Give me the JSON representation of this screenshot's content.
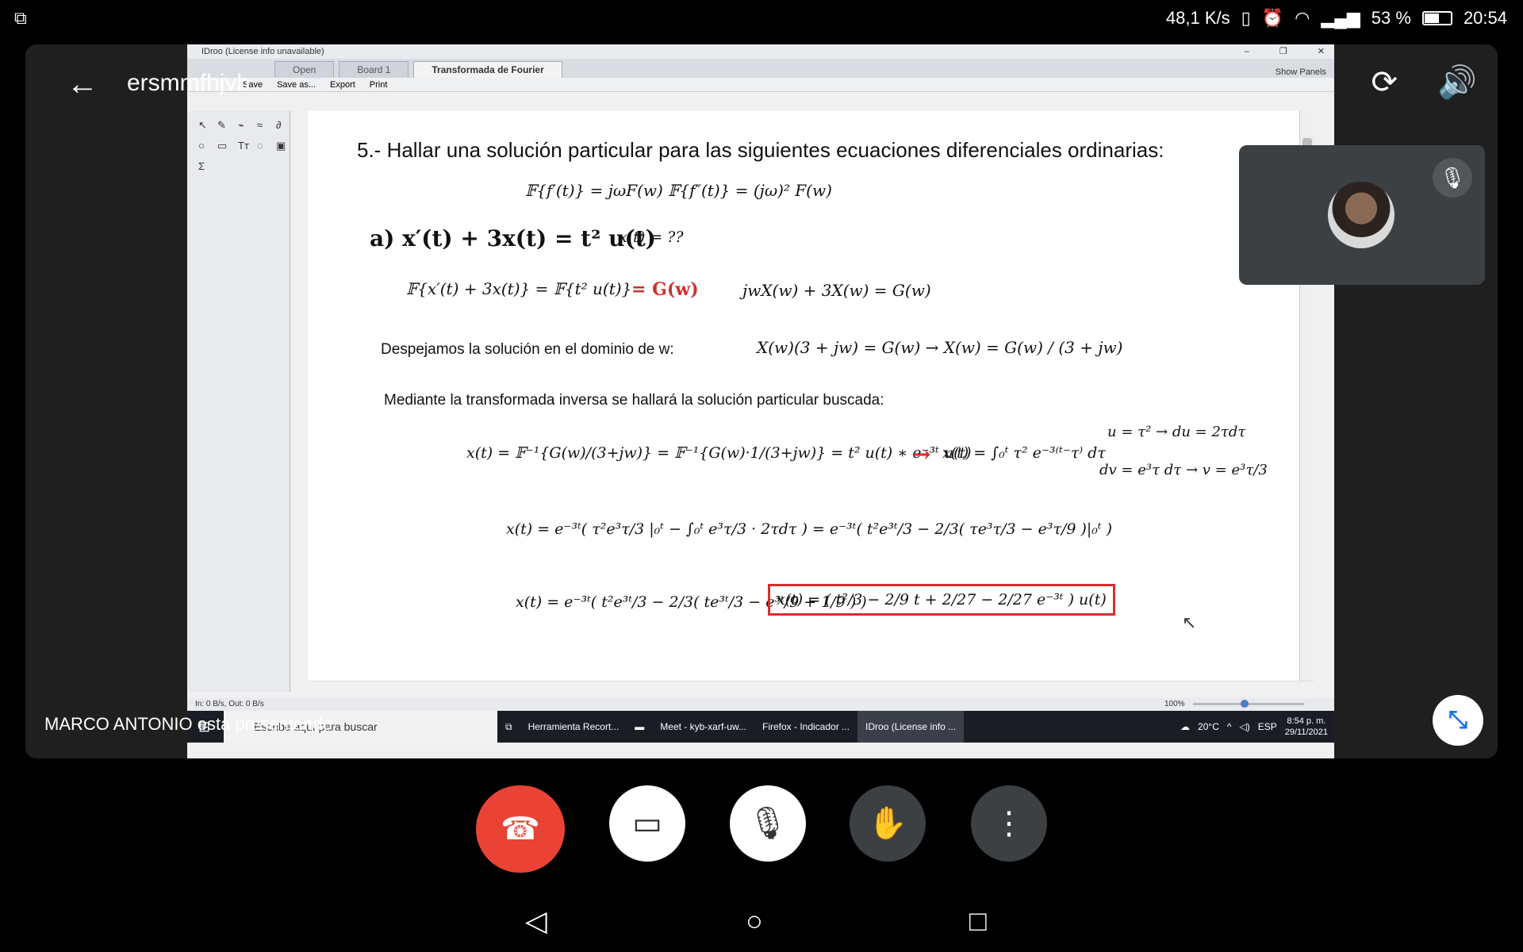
{
  "status": {
    "left_icon": "cast-icon",
    "speed": "48,1 K/s",
    "battery": "53 %",
    "time": "20:54"
  },
  "meeting": {
    "name": "ersmmfhjvb",
    "presenter_text": "MARCO ANTONIO está presentando"
  },
  "app": {
    "title": "IDroo (License info unavailable)",
    "tab1": "Open",
    "tab2": "Board 1",
    "tab3": "Transformada de Fourier",
    "show_panels": "Show Panels",
    "toolbar": {
      "save": "Save",
      "save_as": "Save as...",
      "export": "Export",
      "print": "Print"
    },
    "status_left": "In: 0 B/s, Out: 0 B/s",
    "zoom": "100%"
  },
  "board": {
    "heading": "5.- Hallar una solución particular para las siguientes ecuaciones diferenciales ordinarias:",
    "f1": "𝔽{f′(t)} = jωF(w)     𝔽{f″(t)} = (jω)² F(w)",
    "eq_a": "a)  x′(t) + 3x(t) = t² u(t)",
    "unknown": "x(t) = ??",
    "transform": "𝔽{x′(t) + 3x(t)} = 𝔽{t² u(t)}",
    "g_annot": "= G(w)",
    "freq_eq": "jwX(w) + 3X(w) = G(w)",
    "despejamos": "Despejamos la solución en el dominio de w:",
    "solve": "X(w)(3 + jw) = G(w) →  X(w) = G(w) / (3 + jw)",
    "mediante": "Mediante la transformada inversa se hallará la solución particular buscada:",
    "inverse": "x(t) = 𝔽⁻¹{G(w)/(3+jw)} = 𝔽⁻¹{G(w)·1/(3+jw)} = t² u(t) ∗ e⁻³ᵗ u(t)",
    "arrow": "→",
    "conv": "x(t) = ∫₀ᵗ τ² e⁻³⁽ᵗ⁻τ⁾ dτ",
    "sub1": "u = τ² → du = 2τdτ",
    "sub2": "dv = e³τ dτ → v = e³τ/3",
    "parts": "x(t) = e⁻³ᵗ( τ²e³τ/3 |₀ᵗ − ∫₀ᵗ e³τ/3 · 2τdτ ) = e⁻³ᵗ( t²e³ᵗ/3 − 2/3( τe³τ/3 − e³τ/9 )|₀ᵗ )",
    "expand": "x(t) = e⁻³ᵗ( t²e³ᵗ/3 − 2/3( te³ᵗ/3 − e³ᵗ/9 + 1/9 ) )",
    "result": "x(t) = ( t²/3 − 2/9 t + 2/27 − 2/27 e⁻³ᵗ ) u(t)"
  },
  "taskbar": {
    "search": "Escribe aquí para buscar",
    "app1": "Herramienta Recort...",
    "app2": "Meet - kyb-xarf-uw...",
    "app3": "Firefox - Indicador ...",
    "app4": "IDroo (License info ...",
    "weather": "20°C",
    "lang": "ESP",
    "time": "8:54 p. m.",
    "date": "29/11/2021"
  }
}
